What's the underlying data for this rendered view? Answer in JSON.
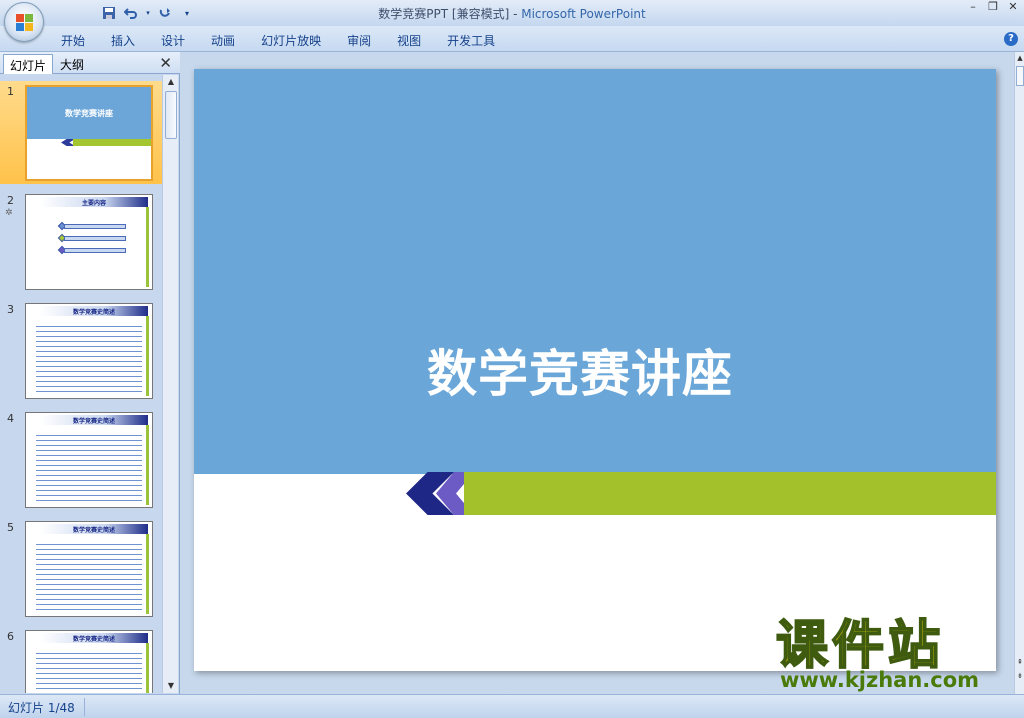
{
  "window": {
    "title_doc": "数学竞赛PPT [兼容模式]",
    "title_sep": " - ",
    "title_app": "Microsoft PowerPoint"
  },
  "qat": {
    "save": "save-icon",
    "undo": "undo-icon",
    "redo": "redo-icon",
    "customize": "▾"
  },
  "ribbon": {
    "tabs": [
      "开始",
      "插入",
      "设计",
      "动画",
      "幻灯片放映",
      "审阅",
      "视图",
      "开发工具"
    ]
  },
  "left_panel": {
    "tab_slides": "幻灯片",
    "tab_outline": "大纲",
    "close": "✕",
    "thumbnails": [
      {
        "num": "1",
        "title": "数学竞赛讲座"
      },
      {
        "num": "2",
        "title": "主要内容"
      },
      {
        "num": "3",
        "title": "数学竞赛史简述"
      },
      {
        "num": "4",
        "title": "数学竞赛史简述"
      },
      {
        "num": "5",
        "title": "数学竞赛史简述"
      },
      {
        "num": "6",
        "title": "数学竞赛史简述"
      }
    ]
  },
  "slide": {
    "title": "数学竞赛讲座"
  },
  "watermark": {
    "cn": "课件站",
    "url": "www.kjzhan.com"
  },
  "status": {
    "slide_indicator": "幻灯片 1/48"
  },
  "colors": {
    "slide_blue": "#6aa7d8",
    "accent_green": "#a2c12b",
    "chevron_navy": "#1f2786",
    "chevron_purple": "#6c5bc4"
  }
}
